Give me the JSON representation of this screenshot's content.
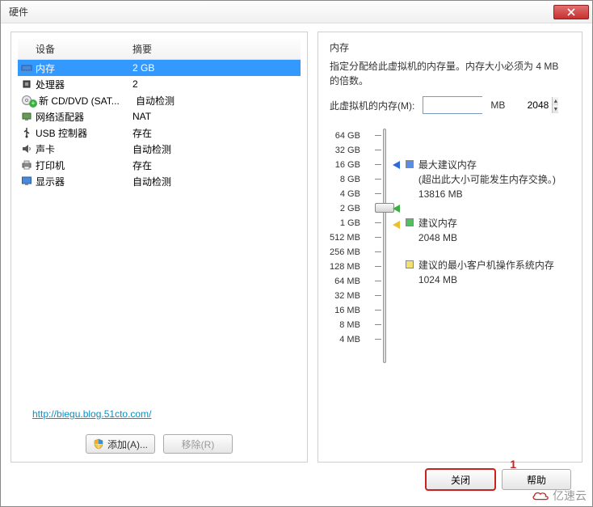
{
  "titlebar": {
    "title": "硬件"
  },
  "table": {
    "header_device": "设备",
    "header_summary": "摘要",
    "rows": [
      {
        "icon": "memory",
        "label": "内存",
        "summary": "2 GB",
        "selected": true
      },
      {
        "icon": "cpu",
        "label": "处理器",
        "summary": "2"
      },
      {
        "icon": "cd",
        "label": "新 CD/DVD (SAT...",
        "summary": "自动检测",
        "badge_add": true
      },
      {
        "icon": "network",
        "label": "网络适配器",
        "summary": "NAT"
      },
      {
        "icon": "usb",
        "label": "USB 控制器",
        "summary": "存在"
      },
      {
        "icon": "sound",
        "label": "声卡",
        "summary": "自动检测"
      },
      {
        "icon": "printer",
        "label": "打印机",
        "summary": "存在"
      },
      {
        "icon": "display",
        "label": "显示器",
        "summary": "自动检测"
      }
    ]
  },
  "buttons": {
    "add": "添加(A)...",
    "remove": "移除(R)",
    "close": "关闭",
    "help": "帮助"
  },
  "link": "http://biegu.blog.51cto.com/",
  "memory": {
    "section_title": "内存",
    "description": "指定分配给此虚拟机的内存量。内存大小必须为 4 MB 的倍数。",
    "field_label": "此虚拟机的内存(M):",
    "value": "2048",
    "unit": "MB",
    "ticks": [
      "64 GB",
      "32 GB",
      "16 GB",
      "8 GB",
      "4 GB",
      "2 GB",
      "1 GB",
      "512 MB",
      "256 MB",
      "128 MB",
      "64 MB",
      "32 MB",
      "16 MB",
      "8 MB",
      "4 MB"
    ],
    "legend": {
      "max": {
        "title": "最大建议内存",
        "note": "(超出此大小可能发生内存交换。)",
        "value": "13816 MB"
      },
      "rec": {
        "title": "建议内存",
        "value": "2048 MB"
      },
      "min": {
        "title": "建议的最小客户机操作系统内存",
        "value": "1024 MB"
      }
    }
  },
  "annotation": {
    "n1": "1"
  },
  "watermark": "亿速云"
}
